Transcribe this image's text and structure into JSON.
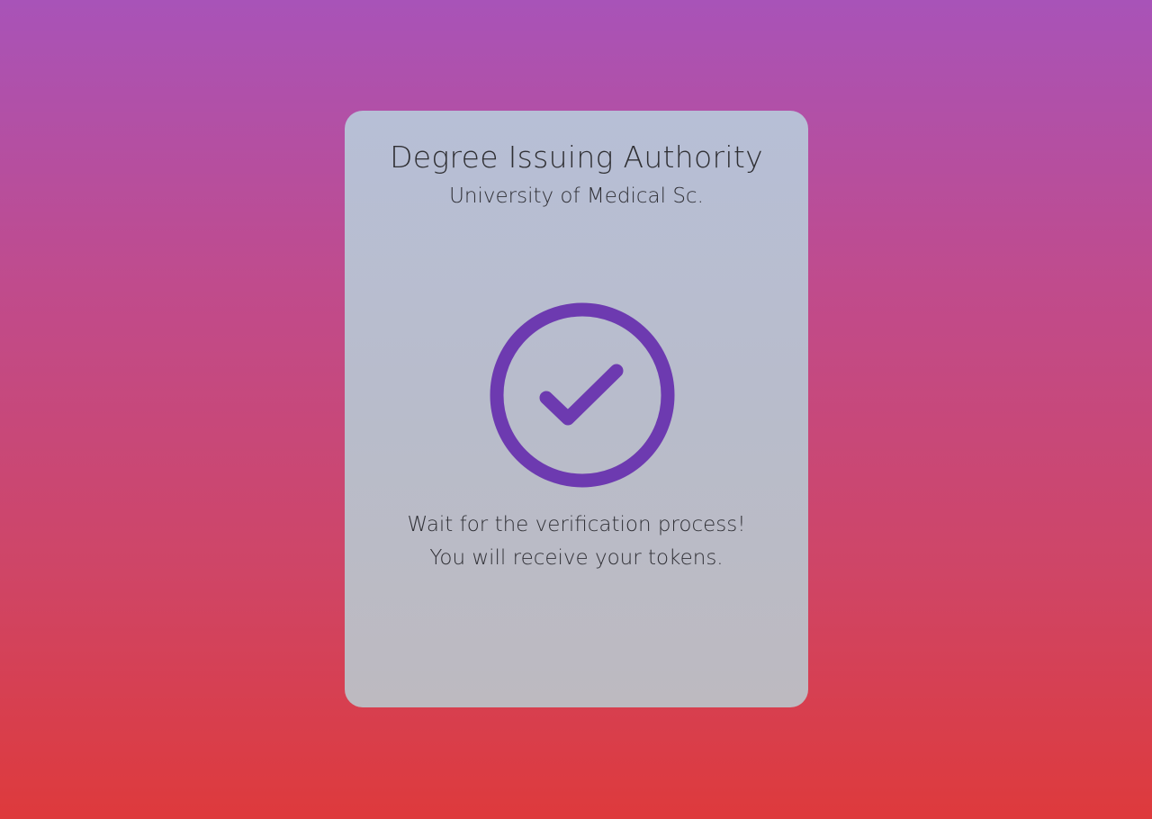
{
  "card": {
    "title": "Degree Issuing Authority",
    "subtitle": "University of Medical Sc.",
    "status_icon": "check-circle-icon",
    "message_line1": "Wait for the verification process!",
    "message_line2": "You will receive your tokens."
  },
  "colors": {
    "accent": "#6d3ab0",
    "background_top": "#a853b8",
    "background_bottom": "#de3a3c",
    "card": "#b8bccb",
    "text": "#303036"
  }
}
